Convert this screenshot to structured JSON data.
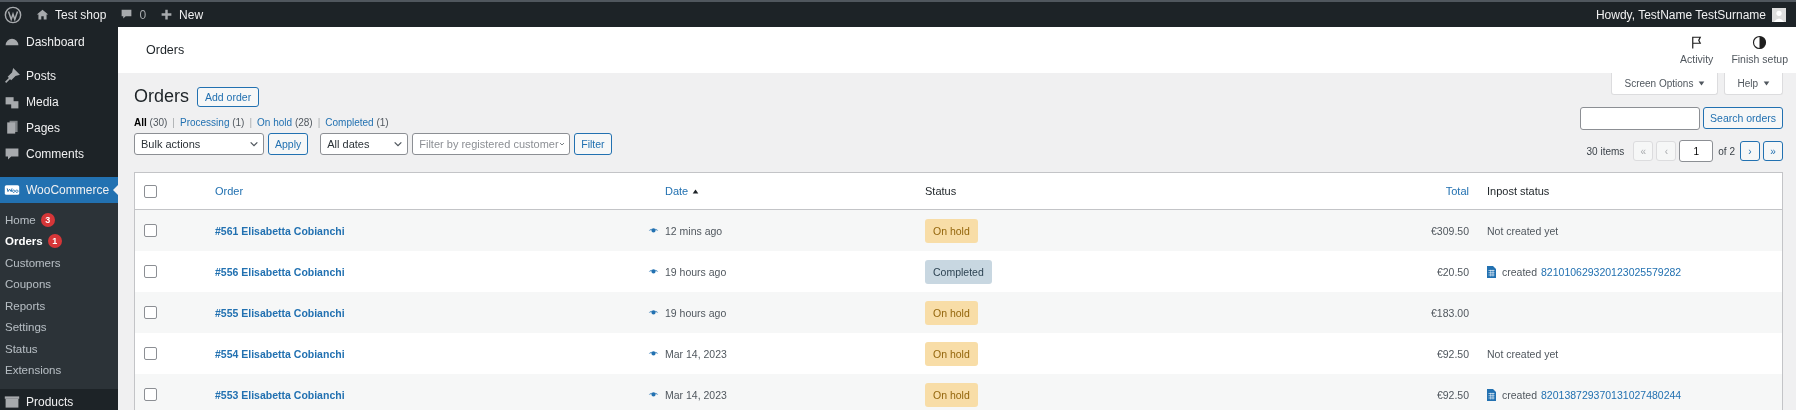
{
  "admin_bar": {
    "site": "Test shop",
    "comments": "0",
    "new": "New",
    "greeting": "Howdy, TestName TestSurname"
  },
  "sidebar": {
    "items": [
      {
        "label": "Dashboard",
        "selected": false
      },
      {
        "label": "Posts",
        "selected": false
      },
      {
        "label": "Media",
        "selected": false
      },
      {
        "label": "Pages",
        "selected": false
      },
      {
        "label": "Comments",
        "selected": false
      },
      {
        "label": "WooCommerce",
        "selected": true,
        "children": [
          {
            "label": "Home",
            "badge": "3",
            "selected": false
          },
          {
            "label": "Orders",
            "badge": "1",
            "selected": true
          },
          {
            "label": "Customers",
            "selected": false
          },
          {
            "label": "Coupons",
            "selected": false
          },
          {
            "label": "Reports",
            "selected": false
          },
          {
            "label": "Settings",
            "selected": false
          },
          {
            "label": "Status",
            "selected": false
          },
          {
            "label": "Extensions",
            "selected": false
          }
        ]
      },
      {
        "label": "Products",
        "selected": false
      }
    ]
  },
  "header": {
    "title": "Orders",
    "actions": [
      "Activity",
      "Finish setup"
    ]
  },
  "screen_tabs": [
    "Screen Options",
    "Help"
  ],
  "page_title": "Orders",
  "add_button": "Add order",
  "status_filters": [
    {
      "label": "All",
      "count": "(30)",
      "selected": true
    },
    {
      "label": "Processing",
      "count": "(1)",
      "selected": false
    },
    {
      "label": "On hold",
      "count": "(28)",
      "selected": false
    },
    {
      "label": "Completed",
      "count": "(1)",
      "selected": false
    }
  ],
  "filter_separators": [
    "|",
    "|",
    "|"
  ],
  "bulk_actions": "Bulk actions",
  "apply": "Apply",
  "dates": "All dates",
  "customer_filter": {
    "placeholder": "Filter by registered customer"
  },
  "filter": "Filter",
  "search": {
    "button": "Search orders"
  },
  "pagination": {
    "count": "30 items",
    "first": "«",
    "prev": "‹",
    "page": "1",
    "of": "of 2",
    "next": "›",
    "last": "»",
    "first_disabled": true,
    "prev_disabled": true
  },
  "table": {
    "all_checked": false,
    "columns": [
      {
        "label": "Order",
        "sortable": true,
        "sorted": false
      },
      {
        "label": "Date",
        "sortable": true,
        "sorted": true
      },
      {
        "label": "Status",
        "sortable": false,
        "sorted": false
      },
      {
        "label": "Total",
        "sortable": true,
        "sorted": false
      },
      {
        "label": "Inpost status",
        "sortable": false,
        "sorted": false
      }
    ],
    "rows": [
      {
        "checked": false,
        "order": "#561 Elisabetta Cobianchi",
        "date": "12 mins ago",
        "status": {
          "label": "On hold",
          "kind": "on-hold"
        },
        "total": "€309.50",
        "inpost": {
          "kind": "none",
          "text": "Not created yet"
        }
      },
      {
        "checked": false,
        "order": "#556 Elisabetta Cobianchi",
        "date": "19 hours ago",
        "status": {
          "label": "Completed",
          "kind": "completed"
        },
        "total": "€20.50",
        "inpost": {
          "kind": "created",
          "text": "created",
          "tracking": "821010629320123025579282"
        }
      },
      {
        "checked": false,
        "order": "#555 Elisabetta Cobianchi",
        "date": "19 hours ago",
        "status": {
          "label": "On hold",
          "kind": "on-hold"
        },
        "total": "€183.00"
      },
      {
        "checked": false,
        "order": "#554 Elisabetta Cobianchi",
        "date": "Mar 14, 2023",
        "status": {
          "label": "On hold",
          "kind": "on-hold"
        },
        "total": "€92.50",
        "inpost": {
          "kind": "none",
          "text": "Not created yet"
        }
      },
      {
        "checked": false,
        "order": "#553 Elisabetta Cobianchi",
        "date": "Mar 14, 2023",
        "status": {
          "label": "On hold",
          "kind": "on-hold"
        },
        "total": "€92.50",
        "inpost": {
          "kind": "created",
          "text": "created",
          "tracking": "820138729370131027480244"
        }
      }
    ]
  }
}
